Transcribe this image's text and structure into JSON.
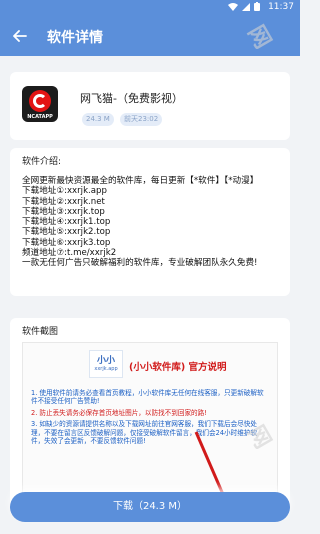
{
  "status_bar": {
    "time": "11:37"
  },
  "header": {
    "title": "软件详情"
  },
  "app": {
    "logo_text": "NCATAPP",
    "name": "网飞猫-（免费影视）",
    "size": "24.3 M",
    "date": "前天23:02"
  },
  "intro": {
    "title": "软件介绍:",
    "text": "全网更新最快资源最全的软件库，每日更新【*软件】【*动漫】\n下载地址①:xxrjk.app\n下载地址②:xxrjk.net\n下载地址③:xxrjk.top\n下载地址④:xxrjk1.top\n下载地址⑤:xxrjk2.top\n下载地址⑥:xxrjk3.top\n频道地址⑦:t.me/xxrjk2\n一款无任何广告只破解福利的软件库，专业破解团队永久免费!"
  },
  "screenshots": {
    "title": "软件截图",
    "logo_big": "小小",
    "logo_small": "xxrjk.app",
    "headline": "(小小软件库) 官方说明",
    "line1": "1. 使用软件前请务必查看首页教程，小小软件库无任何在线客服，只更新破解软件不接受任何广告赞助!",
    "line2": "2. 防止丢失请务必保存首页地址图片，以防找不到回家的路!",
    "line3": "3. 如缺少的资源请提供名称以及下载网址前往官网客服，我们下载后会尽快处理，不要在留言区反馈破解问题，仅接受破解软件留言，我们会24小时维护软件，失效了会更新，不要反馈软件问题!"
  },
  "download": {
    "label": "下载（24.3 M）"
  },
  "colors": {
    "primary": "#5b8fda",
    "red": "#d11a1a"
  }
}
